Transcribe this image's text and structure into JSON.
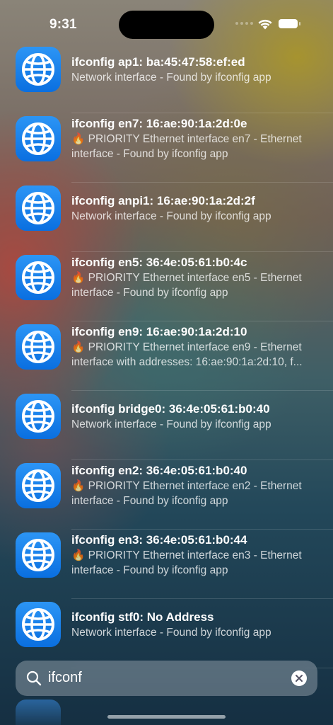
{
  "status_bar": {
    "time": "9:31"
  },
  "results": [
    {
      "title": "ifconfig ap1: ba:45:47:58:ef:ed",
      "subtitle": "Network interface - Found by ifconfig app",
      "priority": false
    },
    {
      "title": "ifconfig en7: 16:ae:90:1a:2d:0e",
      "subtitle": "🔥 PRIORITY Ethernet interface en7 - Ethernet interface - Found by ifconfig app",
      "priority": true
    },
    {
      "title": "ifconfig anpi1: 16:ae:90:1a:2d:2f",
      "subtitle": "Network interface - Found by ifconfig app",
      "priority": false
    },
    {
      "title": "ifconfig en5: 36:4e:05:61:b0:4c",
      "subtitle": "🔥 PRIORITY Ethernet interface en5 - Ethernet interface - Found by ifconfig app",
      "priority": true
    },
    {
      "title": "ifconfig en9: 16:ae:90:1a:2d:10",
      "subtitle_line1": "🔥 PRIORITY Ethernet interface en9 - Ethernet",
      "subtitle_line2": "interface with addresses: 16:ae:90:1a:2d:10, f...",
      "priority": true
    },
    {
      "title": "ifconfig bridge0: 36:4e:05:61:b0:40",
      "subtitle": "Network interface - Found by ifconfig app",
      "priority": false
    },
    {
      "title": "ifconfig en2: 36:4e:05:61:b0:40",
      "subtitle": "🔥 PRIORITY Ethernet interface en2 - Ethernet interface - Found by ifconfig app",
      "priority": true
    },
    {
      "title": "ifconfig en3: 36:4e:05:61:b0:44",
      "subtitle": "🔥 PRIORITY Ethernet interface en3 - Ethernet interface - Found by ifconfig app",
      "priority": true
    },
    {
      "title": "ifconfig stf0: No Address",
      "subtitle": "Network interface - Found by ifconfig app",
      "priority": false
    }
  ],
  "search": {
    "value": "ifconf",
    "icon": "magnifying-glass-icon",
    "clear_icon": "xmark-circle-icon"
  },
  "app_icon": "globe-icon"
}
